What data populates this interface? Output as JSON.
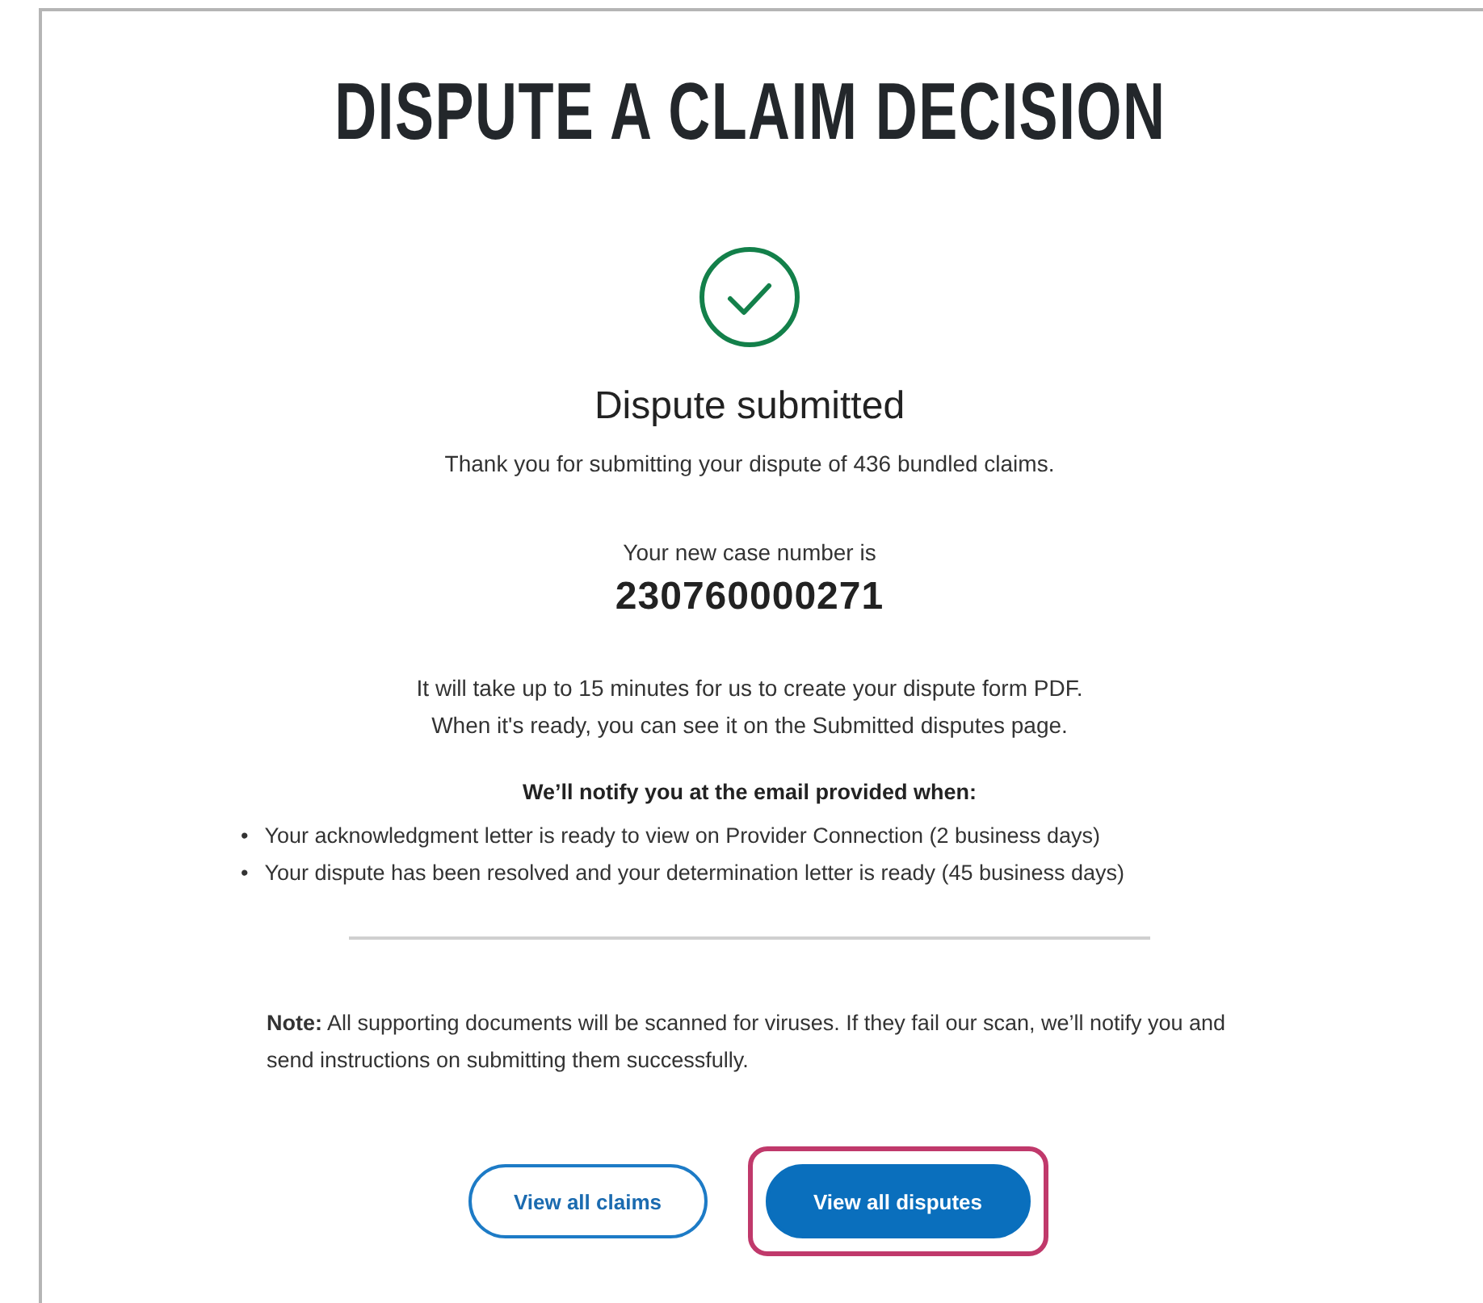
{
  "page_title": "DISPUTE A CLAIM DECISION",
  "status": {
    "heading": "Dispute submitted",
    "message": "Thank you for submitting your dispute of 436 bundled claims."
  },
  "case": {
    "label": "Your new case number is",
    "number": "230760000271"
  },
  "info_lines": [
    "It will take up to 15 minutes for us to create your dispute form PDF.",
    "When it's ready, you can see it on the Submitted disputes page."
  ],
  "notify": {
    "heading": "We’ll notify you at the email provided when:",
    "items": [
      {
        "bullet": "•",
        "text": "Your acknowledgment letter is ready to view on Provider Connection (2 business days)"
      },
      {
        "bullet": "•",
        "text": "Your dispute has been resolved and your determination letter is ready (45 business days)"
      }
    ]
  },
  "note": "**Note:** All supporting documents will be scanned for viruses. If they fail our scan, we’ll notify you and send instructions on submitting them successfully.",
  "buttons": [
    {
      "label": "View all claims",
      "kind": "outline",
      "focused": false
    },
    {
      "label": "View all disputes",
      "kind": "filled",
      "focused": true
    }
  ]
}
